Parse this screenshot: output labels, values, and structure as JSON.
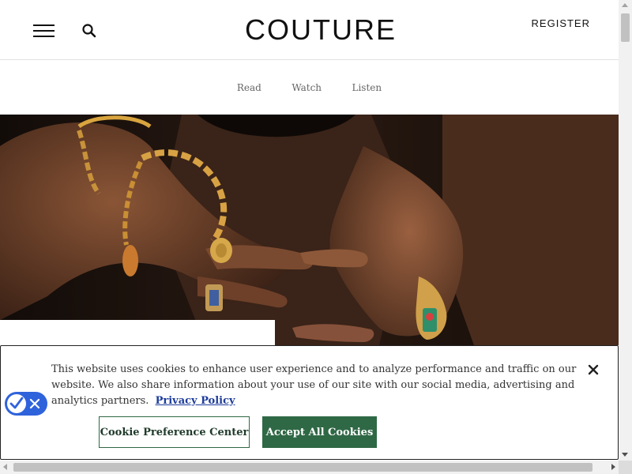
{
  "header": {
    "logo": "COUTURE",
    "register_label": "REGISTER",
    "menu_icon": "hamburger-menu-icon",
    "search_icon": "search-icon"
  },
  "subnav": {
    "items": [
      {
        "label": "Read"
      },
      {
        "label": "Watch"
      },
      {
        "label": "Listen"
      }
    ]
  },
  "hero": {
    "image_subject": "hands wearing gold bracelets and rings"
  },
  "cookie_banner": {
    "message": "This website uses cookies to enhance user experience and to analyze performance and traffic on our website. We also share information about your use of our site with our social media, advertising and analytics partners.",
    "privacy_link": "Privacy Policy",
    "preference_button": "Cookie Preference Center",
    "accept_button": "Accept All Cookies",
    "close_icon": "close-icon",
    "badge_icon": "privacy-choices-icon"
  },
  "colors": {
    "accent_green": "#2f6845",
    "link_blue": "#1e3d9b",
    "badge_blue": "#2f63dc"
  }
}
